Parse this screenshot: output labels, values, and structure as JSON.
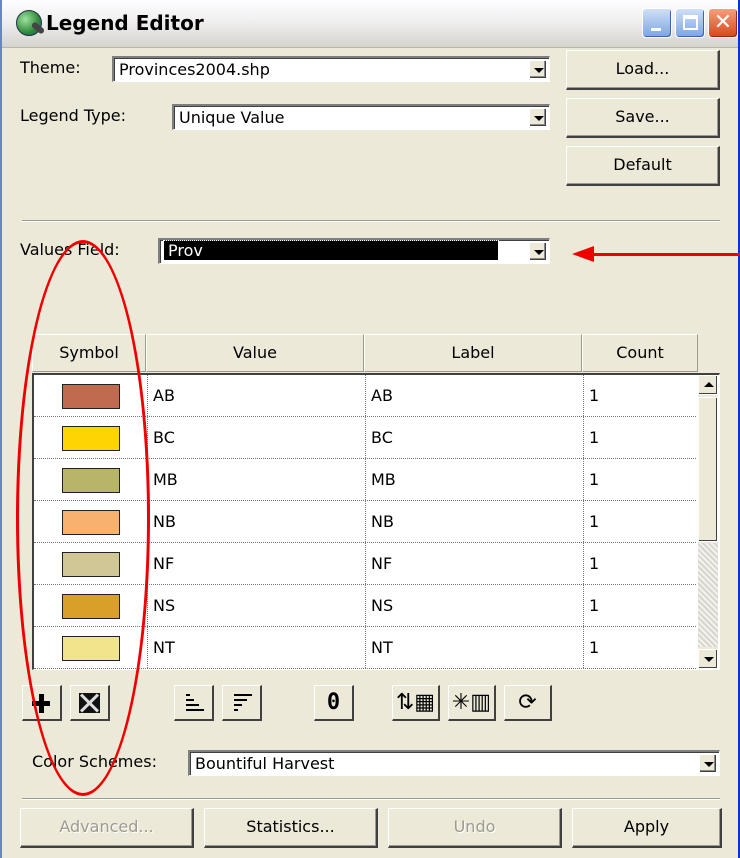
{
  "window": {
    "title": "Legend Editor"
  },
  "theme": {
    "label": "Theme:",
    "value": "Provinces2004.shp"
  },
  "legend_type": {
    "label": "Legend Type:",
    "value": "Unique Value"
  },
  "buttons": {
    "load": "Load...",
    "save": "Save...",
    "default": "Default"
  },
  "values_field": {
    "label": "Values Field:",
    "value": "Prov"
  },
  "table": {
    "headers": {
      "symbol": "Symbol",
      "value": "Value",
      "label": "Label",
      "count": "Count"
    },
    "rows": [
      {
        "color": "#c06a50",
        "value": "AB",
        "label": "AB",
        "count": "1"
      },
      {
        "color": "#ffd400",
        "value": "BC",
        "label": "BC",
        "count": "1"
      },
      {
        "color": "#b8b46a",
        "value": "MB",
        "label": "MB",
        "count": "1"
      },
      {
        "color": "#f8b270",
        "value": "NB",
        "label": "NB",
        "count": "1"
      },
      {
        "color": "#d0c696",
        "value": "NF",
        "label": "NF",
        "count": "1"
      },
      {
        "color": "#d8a028",
        "value": "NS",
        "label": "NS",
        "count": "1"
      },
      {
        "color": "#f0e48c",
        "value": "NT",
        "label": "NT",
        "count": "1"
      }
    ]
  },
  "toolbar": {
    "zero_label": "0"
  },
  "color_schemes": {
    "label": "Color Schemes:",
    "value": "Bountiful Harvest"
  },
  "bottom_buttons": {
    "advanced": "Advanced...",
    "statistics": "Statistics...",
    "undo": "Undo",
    "apply": "Apply"
  },
  "annotation_color": "#e00000"
}
